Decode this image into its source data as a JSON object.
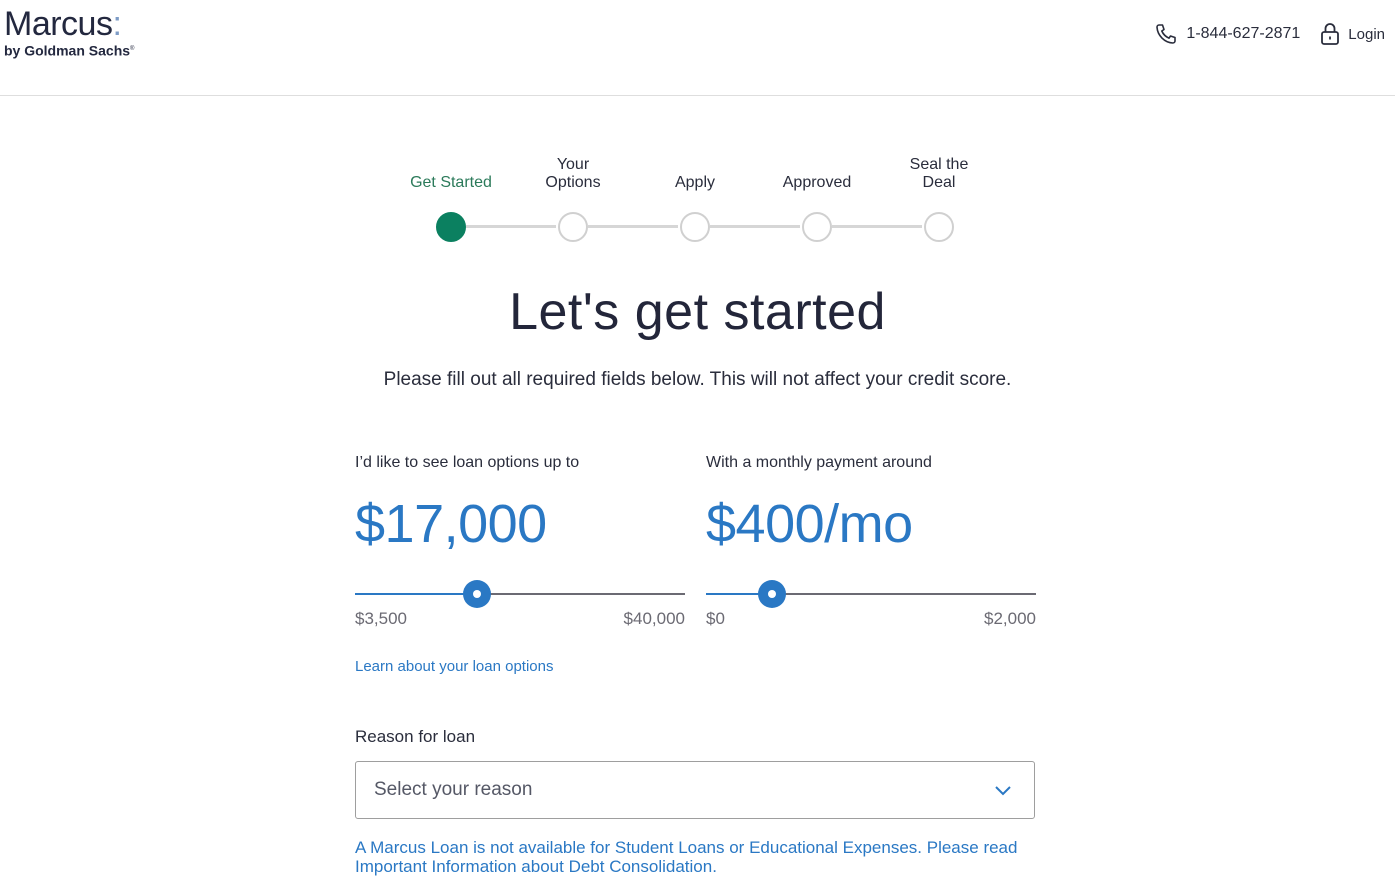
{
  "header": {
    "logo_main": "Marcus",
    "logo_colon": ":",
    "logo_sub": "by Goldman Sachs",
    "logo_registered": "®",
    "phone_icon": "phone-icon",
    "phone_number": "1-844-627-2871",
    "login_icon": "lock-icon",
    "login_label": "Login"
  },
  "stepper": {
    "steps": [
      {
        "label": "Get Started",
        "active": true
      },
      {
        "label": "Your Options",
        "active": false
      },
      {
        "label": "Apply",
        "active": false
      },
      {
        "label": "Approved",
        "active": false
      },
      {
        "label": "Seal the Deal",
        "active": false
      }
    ]
  },
  "main": {
    "title": "Let's get started",
    "subtitle": "Please fill out all required fields below. This will not affect your credit score."
  },
  "loan_amount": {
    "label": "I’d like to see loan options up to",
    "display": "$17,000",
    "value": 17000,
    "min": 3500,
    "max": 40000,
    "min_label": "$3,500",
    "max_label": "$40,000"
  },
  "monthly_payment": {
    "label": "With a monthly payment around",
    "display": "$400/mo",
    "value": 400,
    "min": 0,
    "max": 2000,
    "min_label": "$0",
    "max_label": "$2,000"
  },
  "learn_link": "Learn about your loan options",
  "reason": {
    "label": "Reason for loan",
    "placeholder": "Select your reason",
    "icon": "chevron-down-icon"
  },
  "notice": "A Marcus Loan is not available for Student Loans or Educational Expenses. Please read Important Information about Debt Consolidation.",
  "colors": {
    "accent_blue": "#2a78c4",
    "active_green": "#0b8060",
    "text_dark": "#23263a"
  }
}
